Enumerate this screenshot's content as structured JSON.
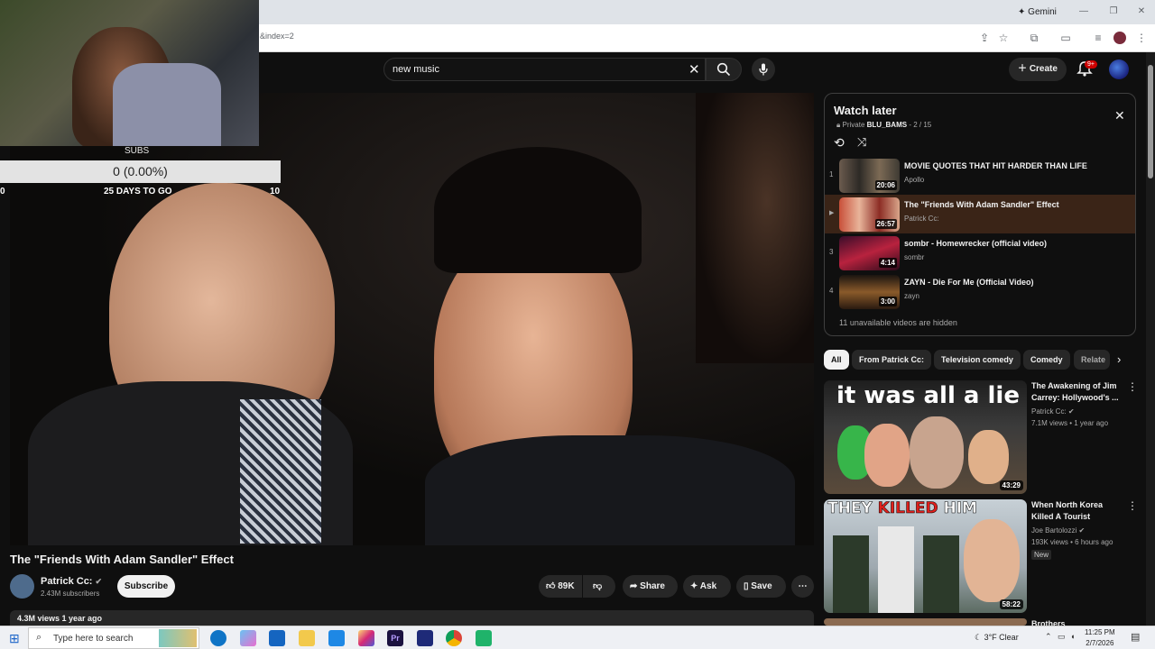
{
  "browser": {
    "url_fragment": "&index=2",
    "gemini_label": "Gemini"
  },
  "header": {
    "search_value": "new music",
    "create_label": "Create",
    "notif_badge": "9+"
  },
  "overlay": {
    "subs_label": "SUBS",
    "progress_text": "0 (0.00%)",
    "min_value": "0",
    "days_text": "25 DAYS TO GO",
    "max_value": "10",
    "progress": 0
  },
  "video": {
    "title": "The \"Friends With Adam Sandler\" Effect",
    "channel": "Patrick Cc:",
    "subscribers": "2.43M subscribers",
    "subscribe_label": "Subscribe",
    "likes": "89K",
    "share_label": "Share",
    "ask_label": "Ask",
    "save_label": "Save",
    "views_line": "4.3M views  1 year ago"
  },
  "playlist": {
    "title": "Watch later",
    "privacy": "Private",
    "owner": "BLU_BAMS",
    "position": "- 2 / 15",
    "hidden_note": "11 unavailable videos are hidden",
    "items": [
      {
        "num": "1",
        "title": "MOVIE QUOTES THAT HIT HARDER THAN LIFE",
        "channel": "Apollo",
        "duration": "20:06"
      },
      {
        "num": "▶",
        "title": "The \"Friends With Adam Sandler\" Effect",
        "channel": "Patrick Cc:",
        "duration": "26:57"
      },
      {
        "num": "3",
        "title": "sombr - Homewrecker (official video)",
        "channel": "sombr",
        "duration": "4:14"
      },
      {
        "num": "4",
        "title": "ZAYN - Die For Me (Official Video)",
        "channel": "zayn",
        "duration": "3:00"
      }
    ]
  },
  "chips": [
    "All",
    "From Patrick Cc:",
    "Television comedy",
    "Comedy",
    "Relate"
  ],
  "recommendations": [
    {
      "title": "The Awakening of Jim Carrey: Hollywood's ...",
      "channel": "Patrick Cc:",
      "meta": "7.1M views • 1 year ago",
      "duration": "43:29",
      "thumb_text": "it was all a lie"
    },
    {
      "title": "When North Korea Killed A Tourist",
      "channel": "Joe Bartolozzi",
      "meta": "193K views • 6 hours ago",
      "badge": "New",
      "duration": "58:22",
      "thumb_text_a": "THEY ",
      "thumb_text_b": "KILLED",
      "thumb_text_c": " HIM"
    },
    {
      "title": "Brothers"
    }
  ],
  "taskbar": {
    "search_placeholder": "Type here to search",
    "weather": "3°F  Clear",
    "time": "11:25 PM",
    "date": "2/7/2026"
  }
}
